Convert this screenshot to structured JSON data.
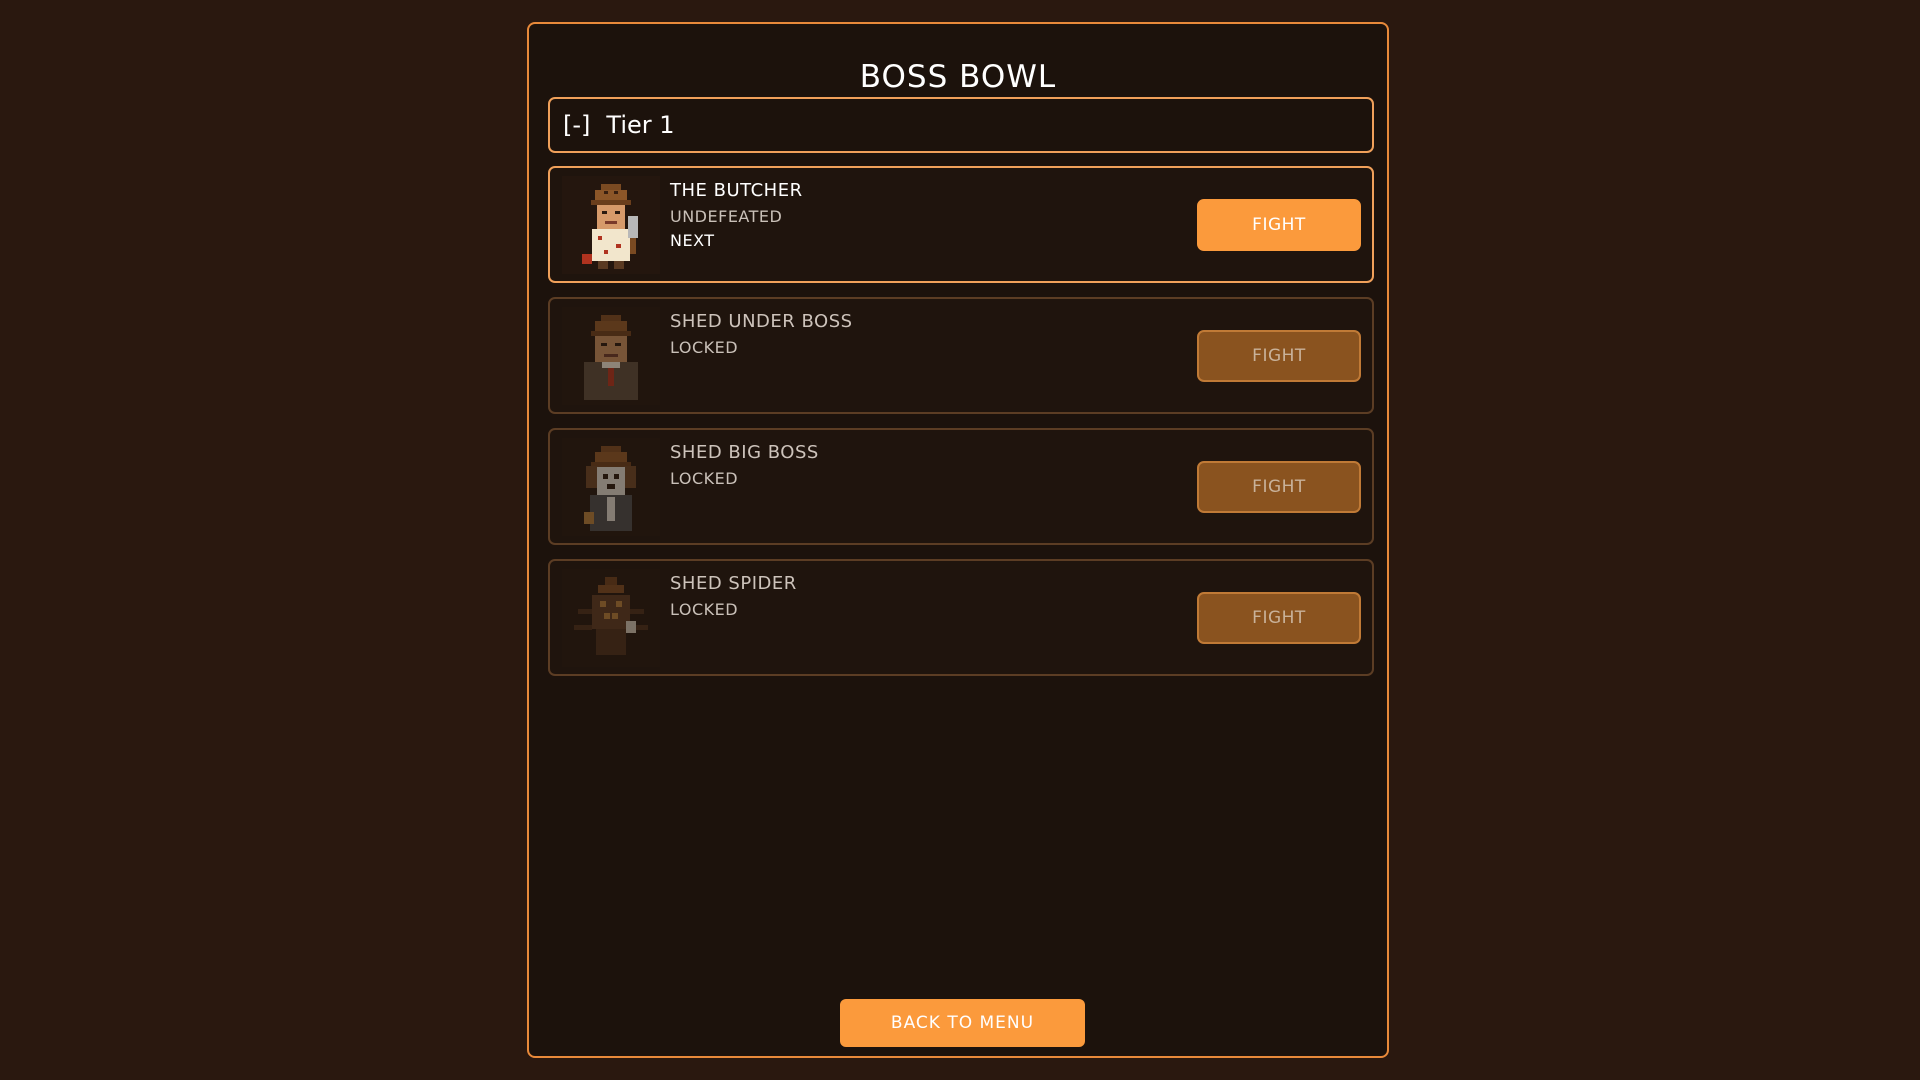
{
  "screen": {
    "title": "BOSS BOWL"
  },
  "tier": {
    "toggle": "[-]",
    "label": "Tier 1",
    "expanded": true
  },
  "bosses": [
    {
      "name": "THE BUTCHER",
      "status": "UNDEFEATED",
      "next_label": "NEXT",
      "fight_label": "FIGHT",
      "locked": false,
      "portrait_icon": "butcher-portrait"
    },
    {
      "name": "SHED UNDER BOSS",
      "status": "LOCKED",
      "fight_label": "FIGHT",
      "locked": true,
      "portrait_icon": "shed-under-boss-portrait"
    },
    {
      "name": "SHED BIG BOSS",
      "status": "LOCKED",
      "fight_label": "FIGHT",
      "locked": true,
      "portrait_icon": "shed-big-boss-portrait"
    },
    {
      "name": "SHED SPIDER",
      "status": "LOCKED",
      "fight_label": "FIGHT",
      "locked": true,
      "portrait_icon": "shed-spider-portrait"
    }
  ],
  "footer": {
    "back_label": "BACK TO MENU"
  },
  "colors": {
    "background": "#2a180f",
    "panel": "#1c120c",
    "accent": "#fb9a3c",
    "border": "#e8893a",
    "disabled_button": "#8a531f"
  }
}
